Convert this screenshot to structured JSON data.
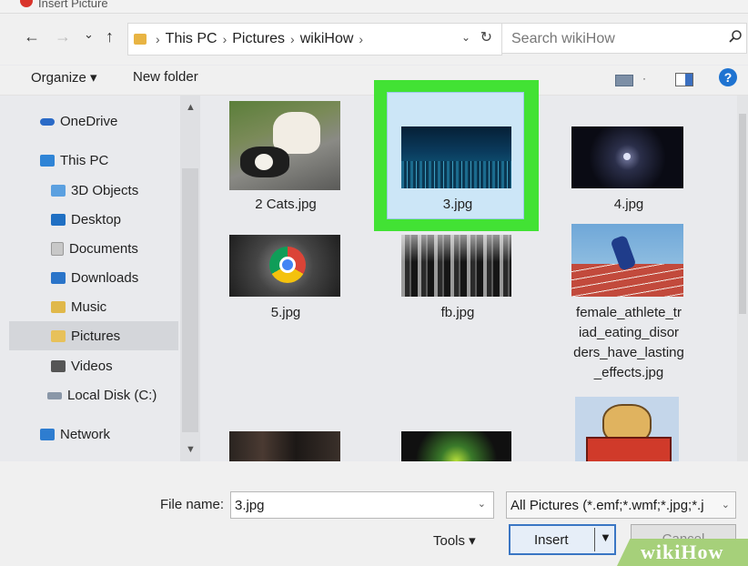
{
  "window": {
    "title": "Insert Picture"
  },
  "nav": {
    "back": "←",
    "forward": "→",
    "recent": "⌄",
    "up": "↑",
    "breadcrumb": [
      "This PC",
      "Pictures",
      "wikiHow"
    ],
    "separator": "›",
    "dropdown": "⌄",
    "refresh": "↻"
  },
  "search": {
    "placeholder": "Search wikiHow",
    "icon": "search-icon"
  },
  "toolbar": {
    "organize": "Organize ▾",
    "new_folder": "New folder"
  },
  "sidebar": {
    "items": [
      {
        "label": "OneDrive",
        "icon": "cloud-icon"
      },
      {
        "label": "This PC",
        "icon": "computer-icon"
      },
      {
        "label": "3D Objects",
        "icon": "3d-objects-icon"
      },
      {
        "label": "Desktop",
        "icon": "desktop-icon"
      },
      {
        "label": "Documents",
        "icon": "documents-icon"
      },
      {
        "label": "Downloads",
        "icon": "downloads-icon"
      },
      {
        "label": "Music",
        "icon": "music-icon"
      },
      {
        "label": "Pictures",
        "icon": "pictures-icon",
        "selected": true
      },
      {
        "label": "Videos",
        "icon": "videos-icon"
      },
      {
        "label": "Local Disk (C:)",
        "icon": "disk-icon"
      },
      {
        "label": "Network",
        "icon": "network-icon"
      }
    ]
  },
  "files": [
    {
      "name": "2 Cats.jpg",
      "thumb": "cats-photo"
    },
    {
      "name": "3.jpg",
      "thumb": "city-night-photo",
      "selected": true
    },
    {
      "name": "4.jpg",
      "thumb": "dark-orb-photo"
    },
    {
      "name": "5.jpg",
      "thumb": "chrome-logo-photo"
    },
    {
      "name": "fb.jpg",
      "thumb": "dark-forest-photo"
    },
    {
      "name_lines": [
        "female_athlete_tr",
        "iad_eating_disor",
        "ders_have_lasting",
        "_effects.jpg"
      ],
      "thumb": "athlete-photo"
    },
    {
      "name": "",
      "thumb": "dark-room-photo"
    },
    {
      "name": "",
      "thumb": "stage-light-photo"
    },
    {
      "name": "",
      "thumb": "cartoon-dog-photo"
    }
  ],
  "footer": {
    "file_name_label": "File name:",
    "file_name_value": "3.jpg",
    "filter": "All Pictures (*.emf;*.wmf;*.jpg;*.j",
    "tools": "Tools ▾",
    "insert": "Insert",
    "cancel": "Cancel"
  },
  "watermark": "wikiHow",
  "colors": {
    "highlight": "#42e234",
    "accent": "#3a76c4"
  }
}
